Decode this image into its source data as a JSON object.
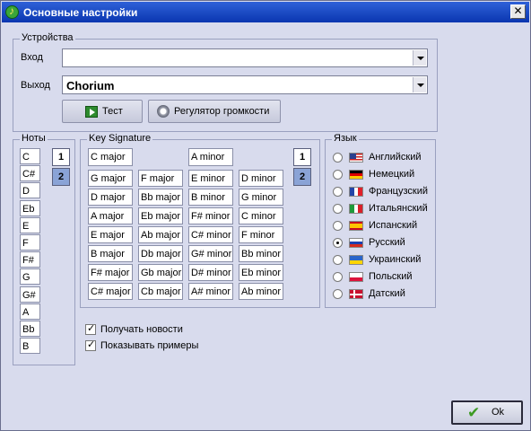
{
  "window": {
    "title": "Основные настройки"
  },
  "devices": {
    "group_label": "Устройства",
    "input_label": "Вход",
    "input_value": "",
    "output_label": "Выход",
    "output_value": "Chorium",
    "test_button": "Тест",
    "volume_button": "Регулятор громкости"
  },
  "notes": {
    "group_label": "Ноты",
    "items": [
      "C",
      "C#",
      "D",
      "Eb",
      "E",
      "F",
      "F#",
      "G",
      "G#",
      "A",
      "Bb",
      "B"
    ],
    "octave_buttons": [
      "1",
      "2"
    ]
  },
  "key_signature": {
    "group_label": "Key Signature",
    "top_row": [
      "C major",
      "A minor"
    ],
    "rows": [
      [
        "G major",
        "F major",
        "E minor",
        "D minor"
      ],
      [
        "D major",
        "Bb major",
        "B minor",
        "G minor"
      ],
      [
        "A major",
        "Eb major",
        "F# minor",
        "C minor"
      ],
      [
        "E major",
        "Ab major",
        "C# minor",
        "F minor"
      ],
      [
        "B major",
        "Db major",
        "G# minor",
        "Bb minor"
      ],
      [
        "F# major",
        "Gb major",
        "D# minor",
        "Eb minor"
      ],
      [
        "C# major",
        "Cb major",
        "A# minor",
        "Ab minor"
      ]
    ],
    "octave_buttons": [
      "1",
      "2"
    ]
  },
  "language": {
    "group_label": "Язык",
    "selected_index": 5,
    "options": [
      {
        "label": "Английский",
        "flag": "us-flag-icon"
      },
      {
        "label": "Немецкий",
        "flag": "german-flag-icon"
      },
      {
        "label": "Французский",
        "flag": "french-flag-icon"
      },
      {
        "label": "Итальянский",
        "flag": "italian-flag-icon"
      },
      {
        "label": "Испанский",
        "flag": "spanish-flag-icon"
      },
      {
        "label": "Русский",
        "flag": "russian-flag-icon"
      },
      {
        "label": "Украинский",
        "flag": "ukrainian-flag-icon"
      },
      {
        "label": "Польский",
        "flag": "polish-flag-icon"
      },
      {
        "label": "Датский",
        "flag": "danish-flag-icon"
      }
    ]
  },
  "options": {
    "receive_news": {
      "label": "Получать новости",
      "checked": true
    },
    "show_examples": {
      "label": "Показывать примеры",
      "checked": true
    }
  },
  "ok_button": "Ok",
  "colors": {
    "title_bar": "#0a36b0",
    "background": "#d8dbed",
    "octave_active": "#ffffff",
    "octave_inactive": "#8aa3d6"
  }
}
